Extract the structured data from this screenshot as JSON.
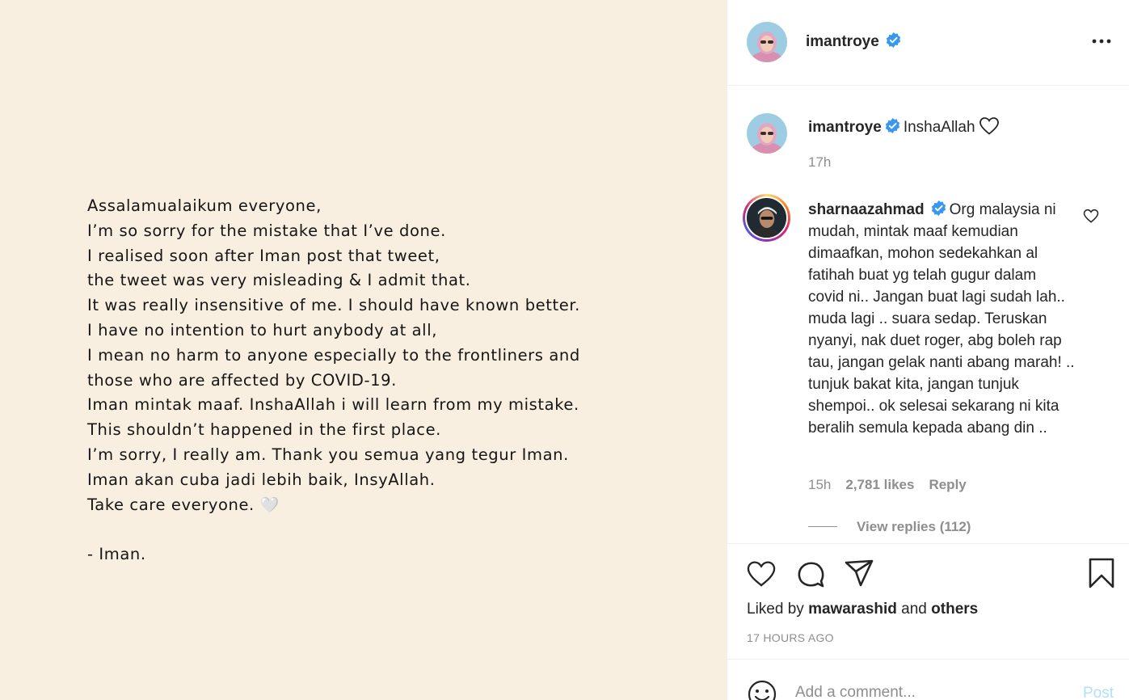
{
  "post": {
    "lines": [
      "Assalamualaikum everyone,",
      "I’m so sorry for the mistake that I’ve done.",
      "I realised soon after Iman post that tweet,",
      "the tweet was very misleading & I admit that.",
      "It was really insensitive of me. I should have known better.",
      "I have no intention to hurt anybody at all,",
      "I mean no harm to anyone especially to the frontliners and",
      "those who are affected by COVID-19.",
      "Iman mintak maaf. InshaAllah i will learn from my mistake.",
      "This shouldn’t happened in the first place.",
      "I’m sorry, I really am. Thank you semua yang tegur Iman.",
      "Iman akan cuba jadi lebih baik, InsyAllah.",
      "Take care everyone.",
      "",
      "- Iman."
    ],
    "heart_emoji": "🤍"
  },
  "header": {
    "username": "imantroye",
    "avatar_icon": "profile-avatar",
    "more_icon": "more-options-icon"
  },
  "caption": {
    "username": "imantroye",
    "text": "InshaAllah",
    "time": "17h"
  },
  "comment": {
    "username": "sharnaazahmad",
    "text": "Org malaysia ni mudah, mintak maaf kemudian dimaafkan, mohon sedekahkan al fatihah buat yg telah gugur dalam covid ni.. Jangan buat lagi sudah lah.. muda lagi .. suara sedap. Teruskan nyanyi, nak duet roger, abg boleh rap tau, jangan gelak nanti abang marah! .. tunjuk bakat kita, jangan tunjuk shempoi.. ok selesai sekarang ni kita beralih semula kepada abang din ..",
    "time": "15h",
    "likes": "2,781 likes",
    "reply_label": "Reply",
    "view_replies": "View replies (112)"
  },
  "actions": {
    "liked_by_prefix": "Liked by",
    "liked_by_user": "mawarashid",
    "liked_by_and": "and",
    "liked_by_others": "others",
    "post_time": "17 HOURS AGO"
  },
  "comment_box": {
    "placeholder": "Add a comment...",
    "post_label": "Post"
  },
  "colors": {
    "post_background": "#f8efe1",
    "verified_blue": "#3897f0",
    "post_button_disabled": "#b2dffc",
    "muted_text": "#8e8e8e"
  }
}
